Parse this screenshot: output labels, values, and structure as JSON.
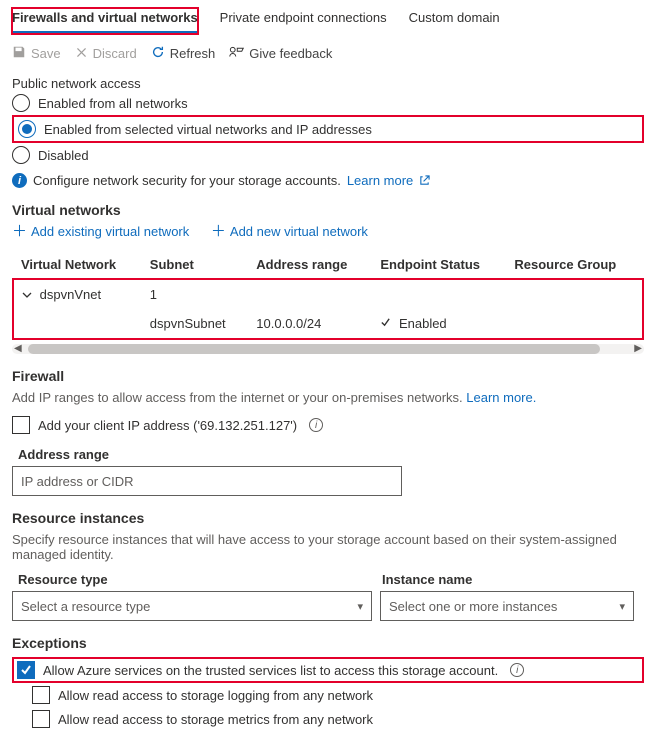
{
  "tabs": {
    "firewalls": "Firewalls and virtual networks",
    "private": "Private endpoint connections",
    "custom": "Custom domain"
  },
  "toolbar": {
    "save": "Save",
    "discard": "Discard",
    "refresh": "Refresh",
    "feedback": "Give feedback"
  },
  "pna": {
    "heading": "Public network access",
    "opt1": "Enabled from all networks",
    "opt2": "Enabled from selected virtual networks and IP addresses",
    "opt3": "Disabled",
    "info": "Configure network security for your storage accounts.",
    "learn": "Learn more"
  },
  "vnets": {
    "heading": "Virtual networks",
    "add_existing": "Add existing virtual network",
    "add_new": "Add new virtual network",
    "cols": {
      "vn": "Virtual Network",
      "sub": "Subnet",
      "ar": "Address range",
      "es": "Endpoint Status",
      "rg": "Resource Group"
    },
    "row1_vn": "dspvnVnet",
    "row1_sub": "1",
    "row2_sub": "dspvnSubnet",
    "row2_ar": "10.0.0.0/24",
    "row2_es": "Enabled"
  },
  "firewall": {
    "heading": "Firewall",
    "desc": "Add IP ranges to allow access from the internet or your on-premises networks.",
    "learn": "Learn more.",
    "client_ip_label": "Add your client IP address ('69.132.251.127')",
    "ar_label": "Address range",
    "ar_placeholder": "IP address or CIDR"
  },
  "ri": {
    "heading": "Resource instances",
    "desc": "Specify resource instances that will have access to your storage account based on their system-assigned managed identity.",
    "col_type": "Resource type",
    "col_name": "Instance name",
    "type_ph": "Select a resource type",
    "name_ph": "Select one or more instances"
  },
  "exc": {
    "heading": "Exceptions",
    "e1": "Allow Azure services on the trusted services list to access this storage account.",
    "e2": "Allow read access to storage logging from any network",
    "e3": "Allow read access to storage metrics from any network"
  }
}
